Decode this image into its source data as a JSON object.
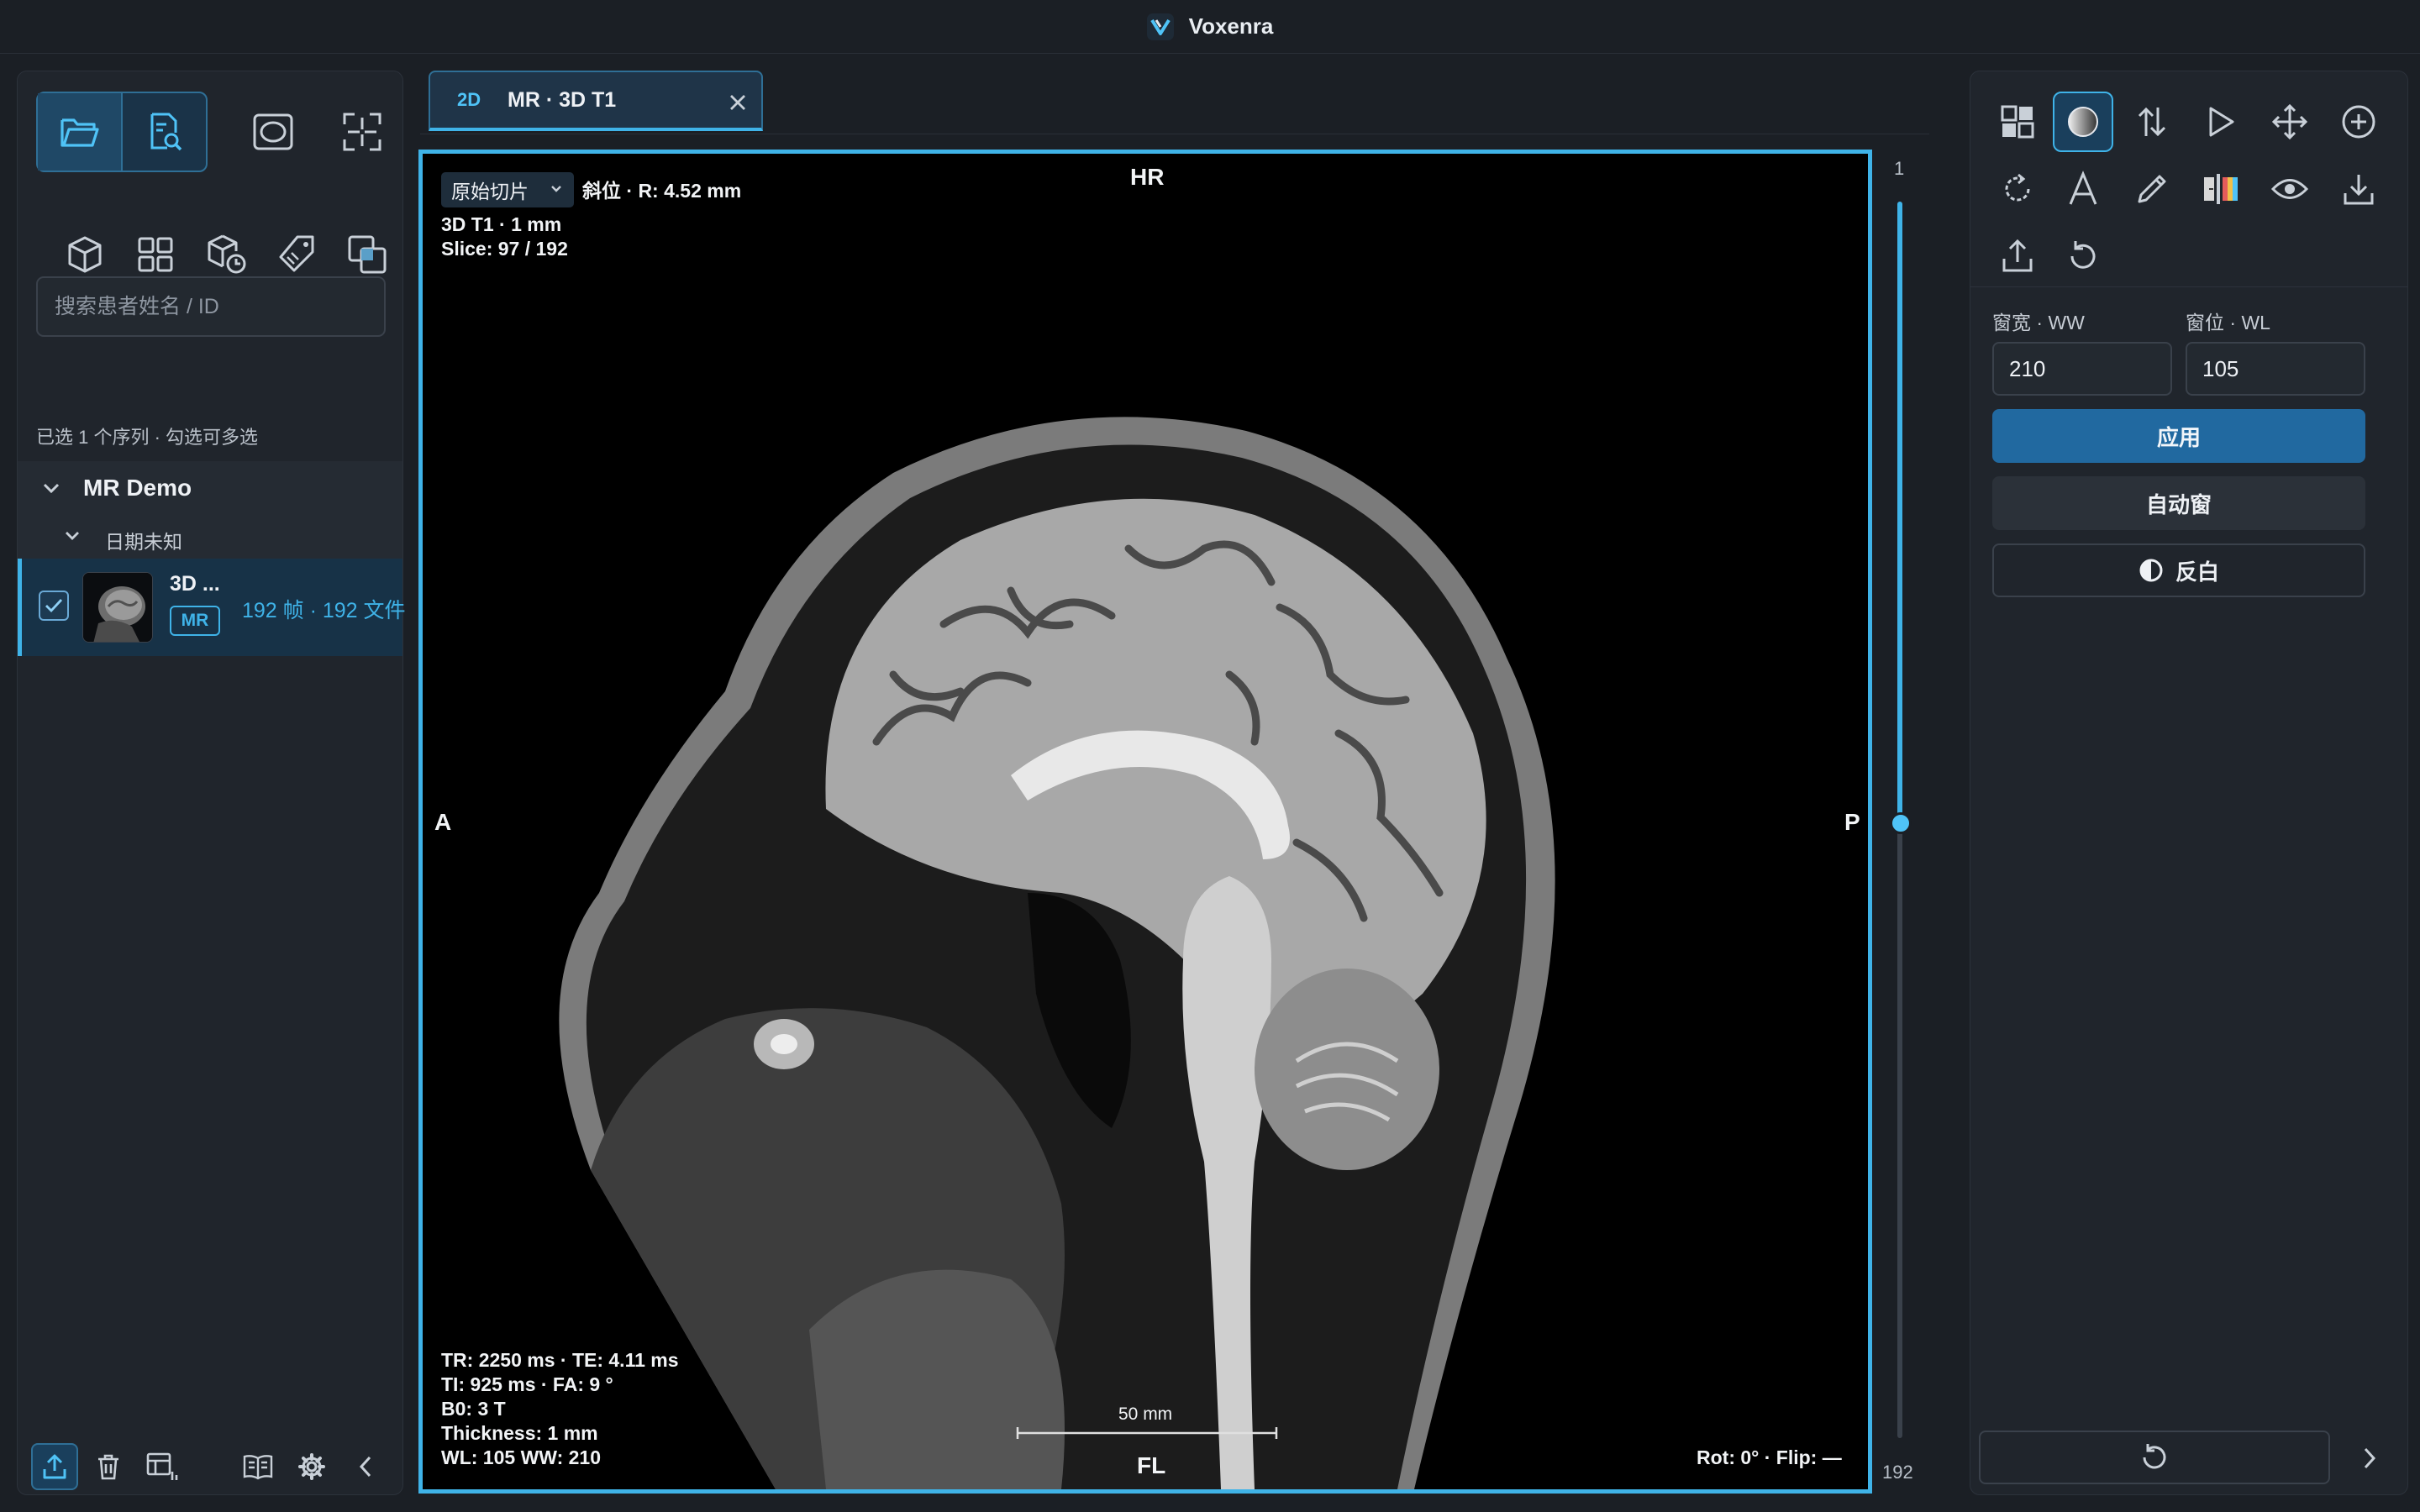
{
  "app": {
    "title": "Voxenra",
    "accent": "#3fb3e8"
  },
  "left_panel": {
    "search": {
      "placeholder": "搜索患者姓名 / ID",
      "value": ""
    },
    "selection_hint": "已选 1 个序列 · 勾选可多选",
    "tree": {
      "patient_name": "MR Demo",
      "date_label": "日期未知",
      "series": {
        "name": "3D ...",
        "modality": "MR",
        "info": "192 帧 · 192 文件",
        "checked": true
      }
    }
  },
  "viewer": {
    "tab": {
      "badge": "2D",
      "label": "MR · 3D T1"
    },
    "overlay": {
      "slice_mode": "原始切片",
      "orientation": "斜位 · R: 4.52 mm",
      "series_desc": "3D T1 · 1 mm",
      "slice": "Slice: 97 / 192",
      "dir_top": "HR",
      "dir_left": "A",
      "dir_right": "P",
      "dir_bottom": "FL",
      "tr_te": "TR: 2250 ms · TE: 4.11 ms",
      "ti_fa": "TI: 925 ms · FA: 9 °",
      "b0": "B0: 3 T",
      "thickness": "Thickness: 1 mm",
      "wl_ww": "WL: 105   WW: 210",
      "scale_label": "50 mm",
      "rot_flip": "Rot: 0° · Flip: —"
    },
    "slider": {
      "min_label": "1",
      "max_label": "192",
      "current": 97,
      "total": 192
    }
  },
  "right_panel": {
    "toolbar_icons": [
      "layout-icon",
      "window-level-icon",
      "stack-scroll-icon",
      "play-icon",
      "pan-icon",
      "zoom-icon",
      "rotate-icon",
      "text-annotation-icon",
      "pencil-icon",
      "colormap-icon",
      "eye-icon",
      "download-icon",
      "export-icon",
      "reset-icon"
    ],
    "ww_label": "窗宽 · WW",
    "wl_label": "窗位 · WL",
    "ww_value": "210",
    "wl_value": "105",
    "apply_label": "应用",
    "auto_label": "自动窗",
    "invert_label": "反白"
  }
}
